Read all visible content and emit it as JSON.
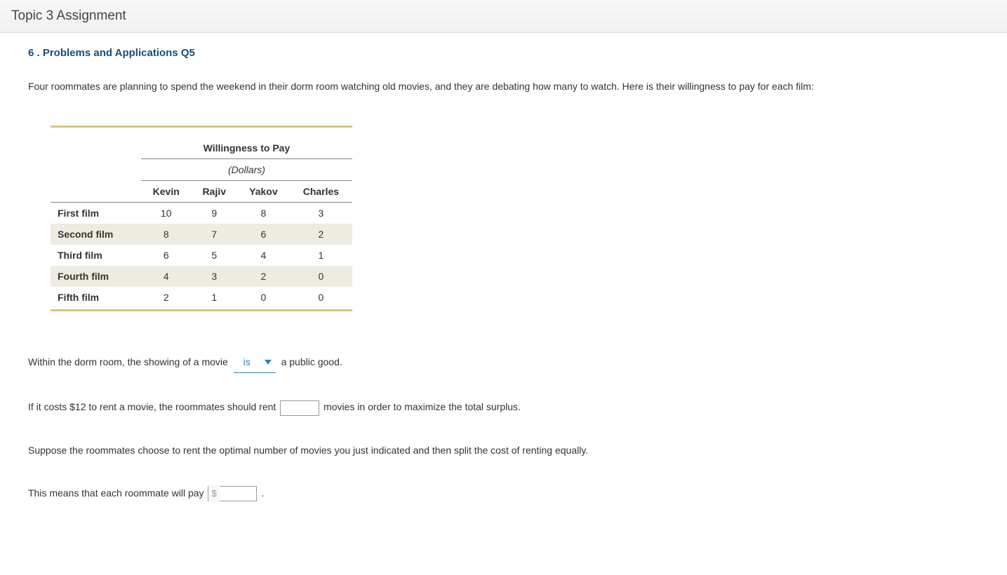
{
  "header": {
    "title": "Topic 3 Assignment"
  },
  "question": {
    "number_label": "6 . Problems and Applications Q5",
    "intro": "Four roommates are planning to spend the weekend in their dorm room watching old movies, and they are debating how many to watch. Here is their willingness to pay for each film:"
  },
  "table": {
    "group_header": "Willingness to Pay",
    "group_subheader": "(Dollars)",
    "columns": [
      "Kevin",
      "Rajiv",
      "Yakov",
      "Charles"
    ],
    "rows": [
      {
        "label": "First film",
        "values": [
          "10",
          "9",
          "8",
          "3"
        ]
      },
      {
        "label": "Second film",
        "values": [
          "8",
          "7",
          "6",
          "2"
        ]
      },
      {
        "label": "Third film",
        "values": [
          "6",
          "5",
          "4",
          "1"
        ]
      },
      {
        "label": "Fourth film",
        "values": [
          "4",
          "3",
          "2",
          "0"
        ]
      },
      {
        "label": "Fifth film",
        "values": [
          "2",
          "1",
          "0",
          "0"
        ]
      }
    ]
  },
  "prompts": {
    "line1_pre": "Within the dorm room, the showing of a movie",
    "line1_dropdown_value": "is",
    "line1_post": "a public good.",
    "line2_pre": "If it costs $12 to rent a movie, the roommates should rent",
    "line2_input_value": "",
    "line2_post": "movies in order to maximize the total surplus.",
    "line3": "Suppose the roommates choose to rent the optimal number of movies you just indicated and then split the cost of renting equally.",
    "line4_pre": "This means that each roommate will pay",
    "line4_currency_prefix": "$",
    "line4_input_value": "",
    "line4_post": "."
  }
}
